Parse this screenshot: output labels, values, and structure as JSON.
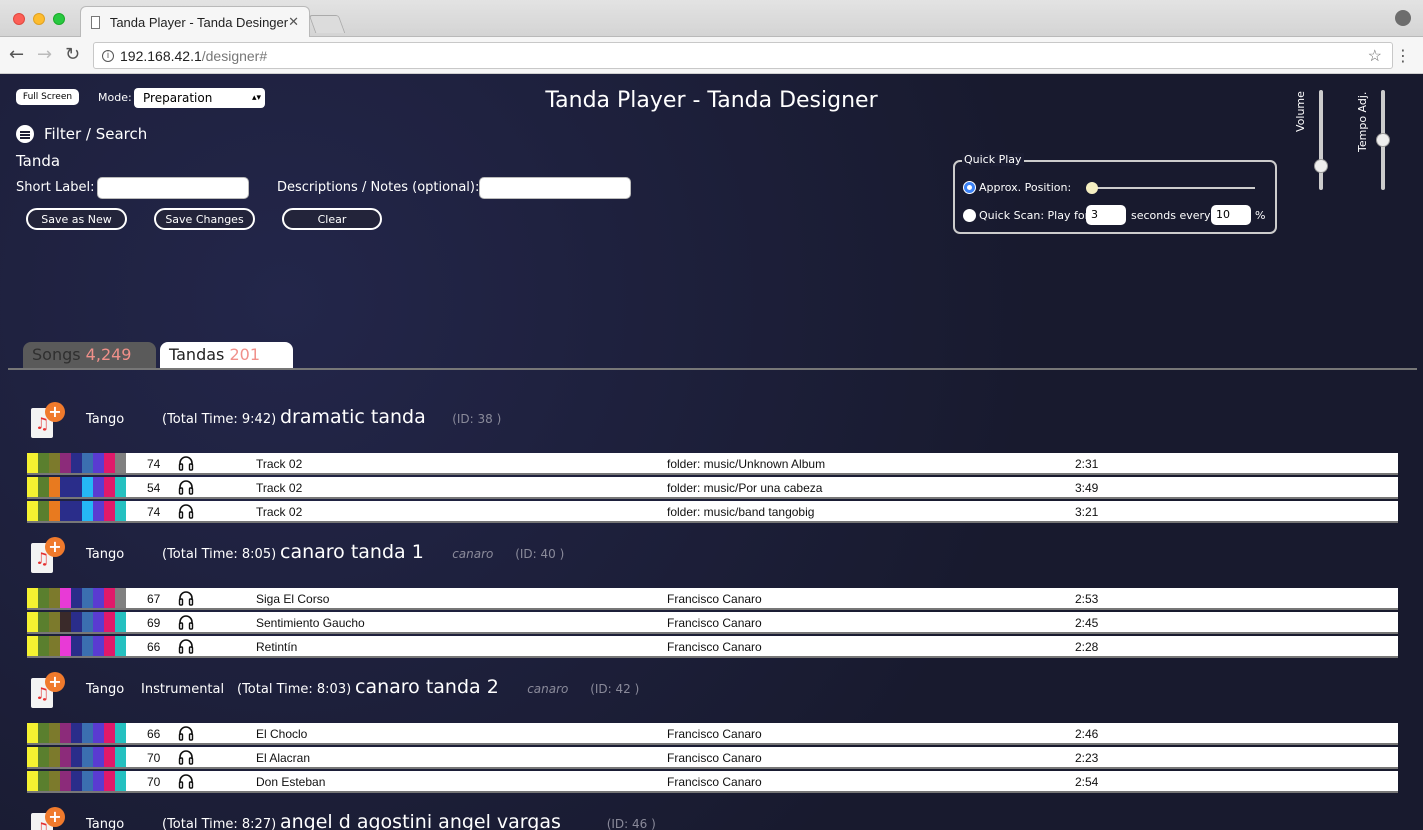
{
  "browser": {
    "tab_title": "Tanda Player - Tanda Desinger",
    "close_glyph": "✕",
    "url_host": "192.168.42.1",
    "url_path": "/designer#",
    "back_glyph": "←",
    "forward_glyph": "→",
    "reload_glyph": "↻",
    "star_glyph": "☆",
    "menu_glyph": "⋮",
    "info_glyph": "i"
  },
  "app": {
    "title": "Tanda Player - Tanda Designer",
    "full_screen_label": "Full Screen",
    "mode_label": "Mode:",
    "mode_value": "Preparation",
    "filter_label": "Filter / Search",
    "tanda_heading": "Tanda",
    "short_label": "Short Label:",
    "short_label_value": "",
    "notes_label": "Descriptions / Notes (optional):",
    "notes_value": "",
    "buttons": {
      "save_as_new": "Save as New",
      "save_changes": "Save Changes",
      "clear": "Clear"
    },
    "quickplay": {
      "legend": "Quick Play",
      "approx_label": "Approx. Position:",
      "approx_position": 0.0,
      "scan_label": "Quick Scan: Play for",
      "seconds_value": "3",
      "seconds_every_label": "seconds every",
      "percent_value": "10",
      "percent_sign": "%"
    },
    "volume_label": "Volume",
    "volume_level": 0.2,
    "tempo_label": "Tempo Adj.",
    "tempo_level": 0.5
  },
  "tabs": {
    "songs_label": "Songs",
    "songs_count": "4,249",
    "tandas_label": "Tandas",
    "tandas_count": "201"
  },
  "colors": {
    "accent_blue": "#3b82f6",
    "count_red": "#f0908a",
    "add_orange": "#f07a2c"
  },
  "tandas": [
    {
      "genre": "Tango",
      "extra": "",
      "total_time": "(Total Time: 9:42)",
      "name": "dramatic tanda",
      "tag": "",
      "id": "(ID: 38 )",
      "songs": [
        {
          "bpm": "74",
          "title": "Track 02",
          "artist": "folder: music/Unknown Album",
          "duration": "2:31",
          "swatches": [
            "#f5f231",
            "#5a7f2e",
            "#7c7a2c",
            "#8c2b7a",
            "#2a2d8a",
            "#3b6fb0",
            "#5a3bd1",
            "#e0196a",
            "#808080"
          ]
        },
        {
          "bpm": "54",
          "title": "Track 02",
          "artist": "folder: music/Por una cabeza",
          "duration": "3:49",
          "swatches": [
            "#f5f231",
            "#5a7f2e",
            "#e87a1f",
            "#2a2d8a",
            "#2a2d8a",
            "#25b7f5",
            "#5a3bd1",
            "#e0196a",
            "#25c0c0"
          ]
        },
        {
          "bpm": "74",
          "title": "Track 02",
          "artist": "folder: music/band tangobig",
          "duration": "3:21",
          "swatches": [
            "#f5f231",
            "#5a7f2e",
            "#e87a1f",
            "#2a2d8a",
            "#2a2d8a",
            "#25b7f5",
            "#5a3bd1",
            "#e0196a",
            "#25c0c0"
          ]
        }
      ]
    },
    {
      "genre": "Tango",
      "extra": "",
      "total_time": "(Total Time: 8:05)",
      "name": "canaro tanda 1",
      "tag": "canaro",
      "id": "(ID: 40 )",
      "songs": [
        {
          "bpm": "67",
          "title": "Siga El Corso",
          "artist": "Francisco Canaro",
          "duration": "2:53",
          "swatches": [
            "#f5f231",
            "#5a7f2e",
            "#7c7a2c",
            "#e83ad6",
            "#2a2d8a",
            "#3b6fb0",
            "#5a3bd1",
            "#e0196a",
            "#808080"
          ]
        },
        {
          "bpm": "69",
          "title": "Sentimiento Gaucho",
          "artist": "Francisco Canaro",
          "duration": "2:45",
          "swatches": [
            "#f5f231",
            "#5a7f2e",
            "#7c7a2c",
            "#3a2a2a",
            "#2a2d8a",
            "#3b6fb0",
            "#5a3bd1",
            "#e0196a",
            "#25c0c0"
          ]
        },
        {
          "bpm": "66",
          "title": "Retintín",
          "artist": "Francisco Canaro",
          "duration": "2:28",
          "swatches": [
            "#f5f231",
            "#5a7f2e",
            "#7c7a2c",
            "#e83ad6",
            "#2a2d8a",
            "#3b6fb0",
            "#5a3bd1",
            "#e0196a",
            "#25c0c0"
          ]
        }
      ]
    },
    {
      "genre": "Tango",
      "extra": "Instrumental",
      "total_time": "(Total Time: 8:03)",
      "name": "canaro tanda 2",
      "tag": "canaro",
      "id": "(ID: 42 )",
      "songs": [
        {
          "bpm": "66",
          "title": "El Choclo",
          "artist": "Francisco Canaro",
          "duration": "2:46",
          "swatches": [
            "#f5f231",
            "#5a7f2e",
            "#7c7a2c",
            "#8c2b7a",
            "#2a2d8a",
            "#3b6fb0",
            "#5a3bd1",
            "#e0196a",
            "#25c0c0"
          ]
        },
        {
          "bpm": "70",
          "title": "El Alacran",
          "artist": "Francisco Canaro",
          "duration": "2:23",
          "swatches": [
            "#f5f231",
            "#5a7f2e",
            "#7c7a2c",
            "#8c2b7a",
            "#2a2d8a",
            "#3b6fb0",
            "#5a3bd1",
            "#e0196a",
            "#25c0c0"
          ]
        },
        {
          "bpm": "70",
          "title": "Don Esteban",
          "artist": "Francisco Canaro",
          "duration": "2:54",
          "swatches": [
            "#f5f231",
            "#5a7f2e",
            "#7c7a2c",
            "#8c2b7a",
            "#2a2d8a",
            "#3b6fb0",
            "#5a3bd1",
            "#e0196a",
            "#25c0c0"
          ]
        }
      ]
    },
    {
      "genre": "Tango",
      "extra": "",
      "total_time": "(Total Time: 8:27)",
      "name": "angel d agostini angel vargas",
      "tag": "",
      "id": "(ID: 46 )",
      "songs": []
    }
  ]
}
